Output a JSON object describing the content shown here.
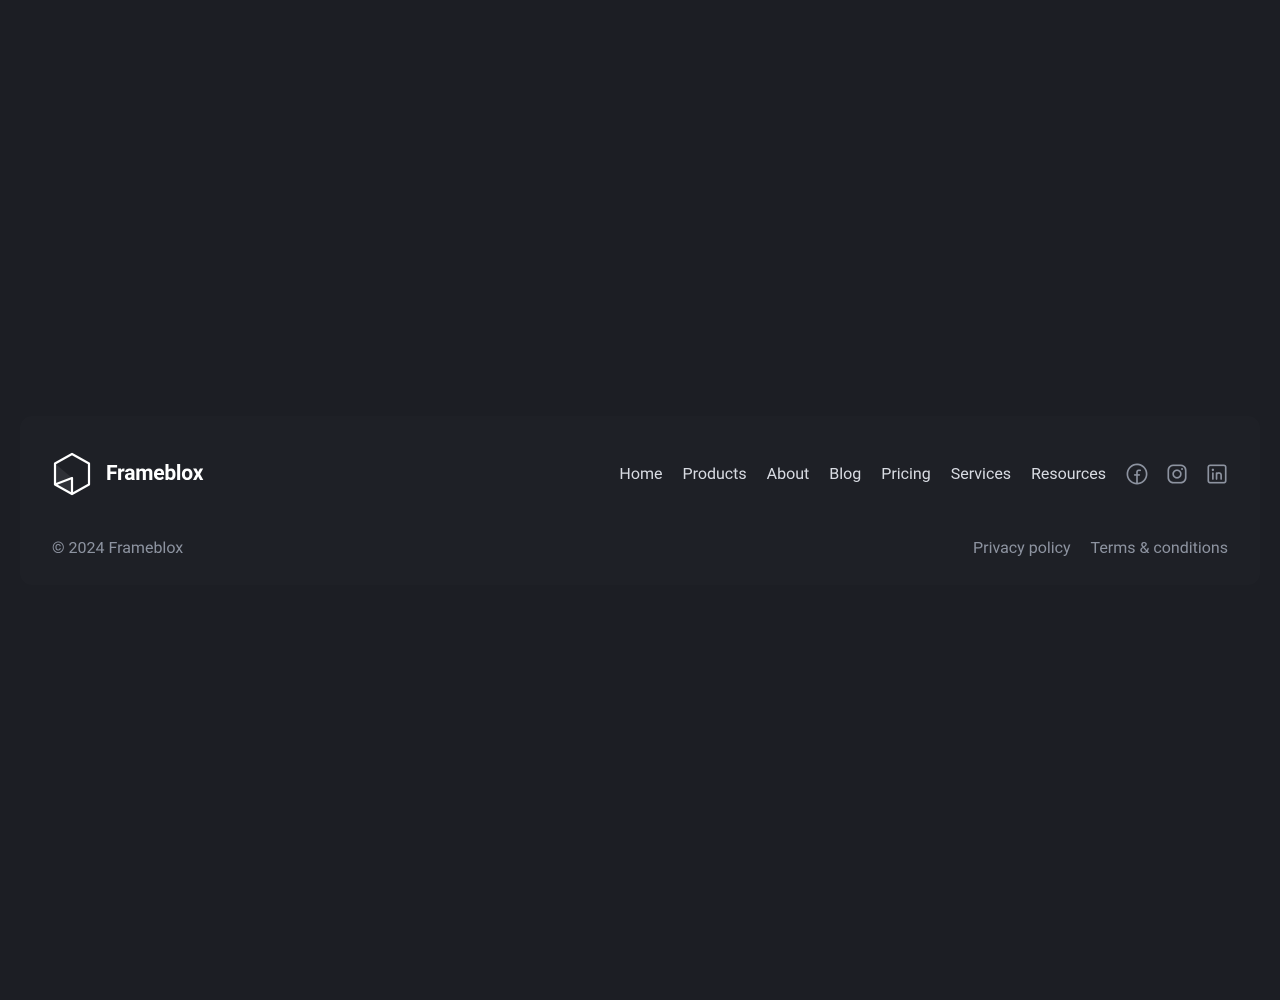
{
  "brand": {
    "name": "Frameblox"
  },
  "nav": {
    "items": [
      {
        "label": "Home"
      },
      {
        "label": "Products"
      },
      {
        "label": "About"
      },
      {
        "label": "Blog"
      },
      {
        "label": "Pricing"
      },
      {
        "label": "Services"
      },
      {
        "label": "Resources"
      }
    ]
  },
  "copyright": "© 2024 Frameblox",
  "legal": {
    "items": [
      {
        "label": "Privacy policy"
      },
      {
        "label": "Terms & conditions"
      }
    ]
  }
}
